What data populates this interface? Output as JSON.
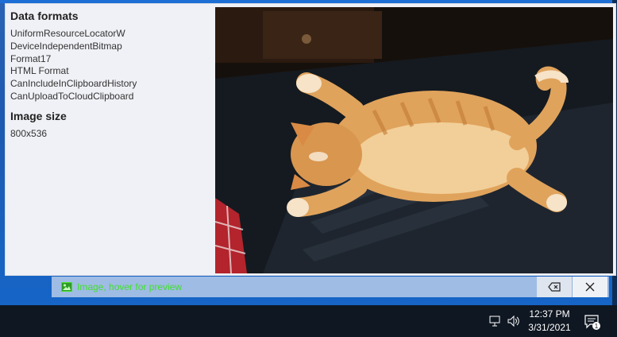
{
  "sidebar": {
    "formats_title": "Data formats",
    "formats": [
      "UniformResourceLocatorW",
      "DeviceIndependentBitmap",
      "Format17",
      "HTML Format",
      "CanIncludeInClipboardHistory",
      "CanUploadToCloudClipboard"
    ],
    "size_title": "Image size",
    "size_value": "800x536"
  },
  "clipboard_item": {
    "label": "Image, hover for preview",
    "icon": "image-icon"
  },
  "buttons": {
    "delete_icon": "backspace-icon",
    "close_icon": "close-icon"
  },
  "taskbar": {
    "time": "12:37 PM",
    "date": "3/31/2021",
    "notification_count": "1"
  },
  "colors": {
    "accent": "#1d6fd6",
    "clip_label": "#41e02a"
  }
}
